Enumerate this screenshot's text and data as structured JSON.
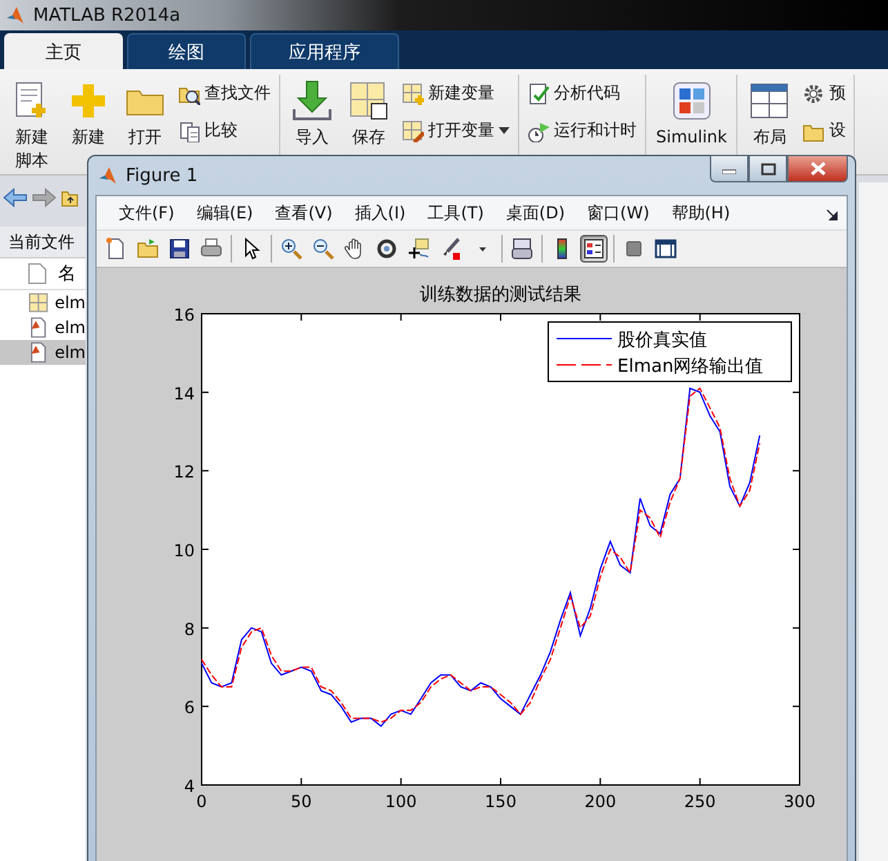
{
  "app": {
    "title": "MATLAB R2014a"
  },
  "tabs": [
    {
      "label": "主页",
      "selected": true
    },
    {
      "label": "绘图",
      "selected": false
    },
    {
      "label": "应用程序",
      "selected": false
    }
  ],
  "ribbon": {
    "groups": [
      {
        "buttons": [
          {
            "kind": "big",
            "label": "新建脚本"
          },
          {
            "kind": "big",
            "label": "新建"
          },
          {
            "kind": "big",
            "label": "打开"
          },
          {
            "kind": "small",
            "label": "查找文件"
          },
          {
            "kind": "small",
            "label": "比较"
          }
        ]
      },
      {
        "buttons": [
          {
            "kind": "big",
            "label": "导入"
          },
          {
            "kind": "big",
            "label": "保存"
          },
          {
            "kind": "small",
            "label": "新建变量"
          },
          {
            "kind": "small",
            "label": "打开变量"
          }
        ]
      },
      {
        "buttons": [
          {
            "kind": "small",
            "label": "分析代码"
          },
          {
            "kind": "small",
            "label": "运行和计时"
          }
        ]
      },
      {
        "buttons": [
          {
            "kind": "big",
            "label": "Simulink"
          }
        ]
      },
      {
        "buttons": [
          {
            "kind": "big",
            "label": "布局"
          },
          {
            "kind": "small",
            "label": "预"
          },
          {
            "kind": "small",
            "label": "设"
          }
        ]
      }
    ]
  },
  "files": {
    "panel_title": "当前文件",
    "column": "名",
    "files": [
      {
        "name": "elm",
        "kind": "data",
        "selected": false
      },
      {
        "name": "elm",
        "kind": "script",
        "selected": false
      },
      {
        "name": "elm",
        "kind": "script",
        "selected": true
      }
    ]
  },
  "figure": {
    "title": "Figure 1",
    "menu": [
      "文件(F)",
      "编辑(E)",
      "查看(V)",
      "插入(I)",
      "工具(T)",
      "桌面(D)",
      "窗口(W)",
      "帮助(H)"
    ],
    "toolbar_groups": [
      {
        "buttons": [
          {
            "pressed": false
          },
          {
            "pressed": false
          },
          {
            "pressed": false
          },
          {
            "pressed": false
          }
        ]
      },
      {
        "buttons": [
          {
            "pressed": false
          }
        ]
      },
      {
        "buttons": [
          {
            "pressed": false
          },
          {
            "pressed": false
          },
          {
            "pressed": false
          },
          {
            "pressed": false
          },
          {
            "pressed": false
          },
          {
            "pressed": false
          },
          {
            "pressed": false
          }
        ]
      },
      {
        "buttons": [
          {
            "pressed": false
          }
        ]
      },
      {
        "buttons": [
          {
            "pressed": false
          },
          {
            "pressed": true
          }
        ]
      },
      {
        "buttons": [
          {
            "pressed": false
          },
          {
            "pressed": false
          }
        ]
      }
    ],
    "chart_data": {
      "type": "line",
      "title": "训练数据的测试结果",
      "x": [
        0,
        5,
        10,
        15,
        20,
        25,
        30,
        35,
        40,
        45,
        50,
        55,
        60,
        65,
        70,
        75,
        80,
        85,
        90,
        95,
        100,
        105,
        110,
        115,
        120,
        125,
        130,
        135,
        140,
        145,
        150,
        155,
        160,
        165,
        170,
        175,
        180,
        185,
        190,
        195,
        200,
        205,
        210,
        215,
        220,
        225,
        230,
        235,
        240,
        245,
        250,
        255,
        260,
        265,
        270,
        275,
        280
      ],
      "series": [
        {
          "name": "股价真实值",
          "color": "#0000ff",
          "line_style": "solid",
          "values": [
            7.1,
            6.6,
            6.5,
            6.6,
            7.7,
            8.0,
            7.9,
            7.1,
            6.8,
            6.9,
            7.0,
            6.9,
            6.4,
            6.3,
            6.0,
            5.6,
            5.7,
            5.7,
            5.5,
            5.8,
            5.9,
            5.8,
            6.2,
            6.6,
            6.8,
            6.8,
            6.5,
            6.4,
            6.6,
            6.5,
            6.2,
            6.0,
            5.8,
            6.3,
            6.8,
            7.4,
            8.2,
            8.9,
            7.8,
            8.5,
            9.5,
            10.2,
            9.6,
            9.4,
            11.3,
            10.6,
            10.4,
            11.4,
            11.8,
            14.1,
            14.0,
            13.4,
            13.0,
            11.6,
            11.1,
            11.7,
            12.9
          ]
        },
        {
          "name": "Elman网络输出值",
          "color": "#ff0000",
          "line_style": "dashed",
          "values": [
            7.2,
            6.8,
            6.5,
            6.5,
            7.5,
            7.9,
            8.0,
            7.3,
            6.9,
            6.9,
            7.0,
            7.0,
            6.5,
            6.4,
            6.1,
            5.7,
            5.7,
            5.7,
            5.6,
            5.7,
            5.9,
            5.9,
            6.1,
            6.5,
            6.7,
            6.8,
            6.6,
            6.4,
            6.5,
            6.5,
            6.3,
            6.1,
            5.8,
            6.1,
            6.7,
            7.2,
            8.0,
            8.8,
            8.0,
            8.3,
            9.3,
            10.0,
            9.8,
            9.4,
            11.0,
            10.8,
            10.3,
            11.2,
            11.8,
            13.9,
            14.1,
            13.6,
            13.1,
            11.8,
            11.1,
            11.5,
            12.7
          ]
        }
      ],
      "xlim": [
        0,
        300
      ],
      "ylim": [
        4,
        16
      ],
      "xticks": [
        0,
        50,
        100,
        150,
        200,
        250,
        300
      ],
      "yticks": [
        4,
        6,
        8,
        10,
        12,
        14,
        16
      ],
      "legend": true
    }
  }
}
